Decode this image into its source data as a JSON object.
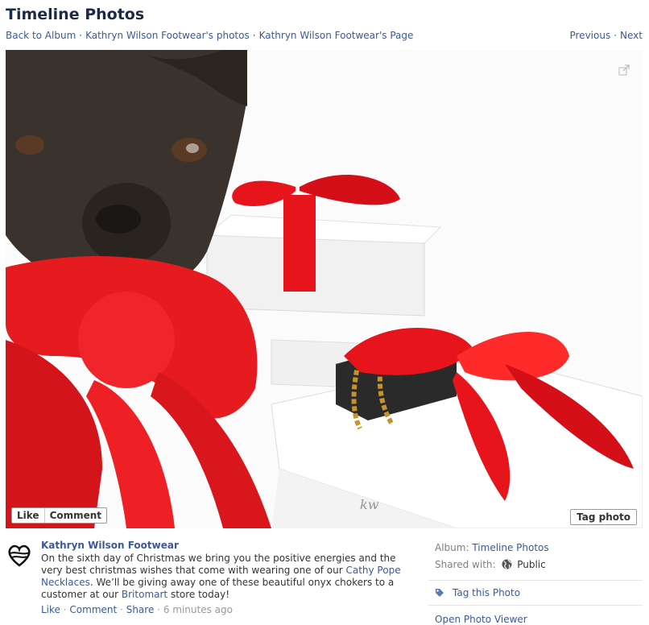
{
  "page": {
    "title": "Timeline Photos"
  },
  "breadcrumb": {
    "items": [
      "Back to Album",
      "Kathryn Wilson Footwear's photos",
      "Kathryn Wilson Footwear's Page"
    ],
    "separator": "·"
  },
  "pager": {
    "previous": "Previous",
    "next": "Next",
    "separator": "·"
  },
  "photo_actions": {
    "like": "Like",
    "comment": "Comment",
    "tag": "Tag photo"
  },
  "post": {
    "author": "Kathryn Wilson Footwear",
    "text_1": "On the sixth day of Christmas we bring you the positive energies and the very best christmas wishes that come with wearing one of our ",
    "link_1": "Cathy Pope Necklaces",
    "text_2": ". We’ll be giving away one of these beautiful onyx chokers to a customer at our ",
    "link_2": "Britomart",
    "text_3": " store today!",
    "meta": {
      "like": "Like",
      "comment": "Comment",
      "share": "Share",
      "time": "6 minutes ago",
      "separator": "·"
    }
  },
  "sidebar": {
    "album_label": "Album:",
    "album_value": "Timeline Photos",
    "shared_label": "Shared with:",
    "shared_value": "Public",
    "tag_action": "Tag this Photo",
    "open_viewer": "Open Photo Viewer"
  },
  "colors": {
    "link": "#3b5998",
    "ribbon": "#e8141b",
    "title": "#1c2a47"
  },
  "icons": [
    "expand-icon",
    "tag-icon",
    "globe-icon",
    "avatar-heart-logo"
  ]
}
